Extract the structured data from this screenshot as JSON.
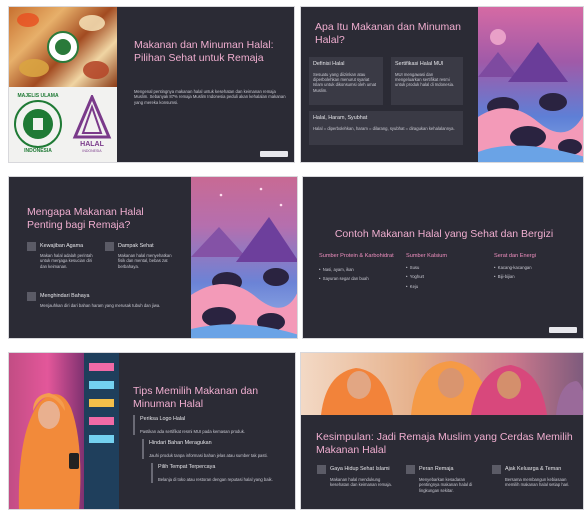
{
  "slide1": {
    "title": "Makanan dan Minuman Halal: Pilihan Sehat untuk Remaja",
    "body": "Mengenal pentingnya makanan halal untuk kesehatan dan keimanan remaja Muslim. Sebanyak 87% remaja Muslim Indonesia peduli akan kehalalan makanan yang mereka konsumsi.",
    "mui_top": "MAJELIS ULAMA",
    "mui_bottom": "INDONESIA",
    "halal_text": "HALAL",
    "halal_sub": "INDONESIA"
  },
  "slide2": {
    "title": "Apa Itu Makanan dan Minuman Halal?",
    "card1_title": "Definisi Halal",
    "card1_body": "Sesuatu yang diizinkan atau diperbolehkan menurut syariat Islam untuk dikonsumsi oleh umat Muslim.",
    "card2_title": "Sertifikasi Halal MUI",
    "card2_body": "MUI mengawasi dan mengeluarkan sertifikat resmi untuk produk halal di Indonesia.",
    "card3_title": "Halal, Haram, Syubhat",
    "card3_body": "Halal = diperbolehkan, haram = dilarang, syubhat = diragukan kehalalannya."
  },
  "slide3": {
    "title": "Mengapa Makanan Halal Penting bagi Remaja?",
    "item1_title": "Kewajiban Agama",
    "item1_body": "Makan halal adalah perintah untuk menjaga kesucian diri dan keimanan.",
    "item2_title": "Dampak Sehat",
    "item2_body": "Makanan halal menyehatkan fisik dan mental, bebas zat berbahaya.",
    "item3_title": "Menghindari Bahaya",
    "item3_body": "Menjauhkan diri dari bahan haram yang merusak tubuh dan jiwa."
  },
  "slide4": {
    "title": "Contoh Makanan Halal yang Sehat dan Bergizi",
    "col1_title": "Sumber Protein & Karbohidrat",
    "col1_items": [
      "Nasi, ayam, ikan",
      "Sayuran segar dan buah"
    ],
    "col2_title": "Sumber Kalsium",
    "col2_items": [
      "Susu",
      "Yoghurt",
      "Keju"
    ],
    "col3_title": "Serat dan Energi",
    "col3_items": [
      "Kacang-kacangan",
      "Biji-bijian"
    ]
  },
  "slide5": {
    "title": "Tips Memilih Makanan dan Minuman Halal",
    "tip1_title": "Periksa Logo Halal",
    "tip1_body": "Pastikan ada sertifikat resmi MUI pada kemasan produk.",
    "tip2_title": "Hindari Bahan Meragukan",
    "tip2_body": "Jauhi produk tanpa informasi bahan jelas atau sumber tak pasti.",
    "tip3_title": "Pilih Tempat Terpercaya",
    "tip3_body": "Belanja di toko atau restoran dengan reputasi halal yang baik."
  },
  "slide6": {
    "title": "Kesimpulan: Jadi Remaja Muslim yang Cerdas Memilih Makanan Halal",
    "item1_title": "Gaya Hidup Sehat Islami",
    "item1_body": "Makanan halal mendukung kesehatan dan keimanan remaja.",
    "item2_title": "Peran Remaja",
    "item2_body": "Menyebarkan kesadaran pentingnya makanan halal di lingkungan sekitar.",
    "item3_title": "Ajak Keluarga & Teman",
    "item3_body": "Bersama membangun kebiasaan memilih makanan halal setiap hari."
  },
  "colors": {
    "slide_bg": "#2b2b35",
    "title_pink": "#f0aed0",
    "card_bg": "#3a3a45"
  }
}
